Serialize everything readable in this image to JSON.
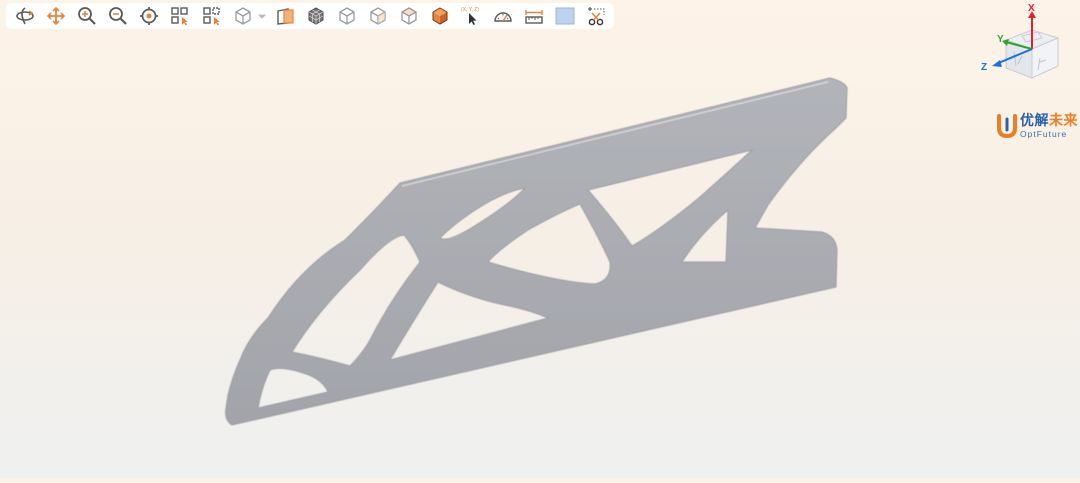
{
  "toolbar": {
    "tools": [
      {
        "name": "rotate-view-icon"
      },
      {
        "name": "pan-icon"
      },
      {
        "name": "zoom-in-icon"
      },
      {
        "name": "zoom-out-icon"
      },
      {
        "name": "fit-center-icon"
      },
      {
        "name": "select-grid-icon"
      },
      {
        "name": "box-select-icon"
      },
      {
        "name": "cube-view-icon",
        "has_dropdown": true
      },
      {
        "name": "section-plane-icon"
      },
      {
        "name": "mesh-display-icon"
      },
      {
        "name": "front-view-icon"
      },
      {
        "name": "side-view-icon"
      },
      {
        "name": "top-view-icon"
      },
      {
        "name": "iso-view-icon"
      },
      {
        "name": "probe-point-icon",
        "label": "(X, Y, Z)"
      },
      {
        "name": "angle-measure-icon"
      },
      {
        "name": "distance-measure-icon"
      },
      {
        "name": "background-color-icon"
      },
      {
        "name": "screenshot-cut-icon"
      }
    ],
    "accent_color": "#e8833a",
    "icon_color": "#5a5a5a"
  },
  "axis_triad": {
    "x_label": "X",
    "y_label": "Y",
    "z_label": "Z",
    "x_color": "#e8202a",
    "y_color": "#2aa52a",
    "z_color": "#1e6fd9"
  },
  "brand": {
    "name_cn_part1": "优解",
    "name_cn_part2": "未来",
    "name_en": "OptFuture"
  },
  "model": {
    "color": "#a9abb1"
  }
}
